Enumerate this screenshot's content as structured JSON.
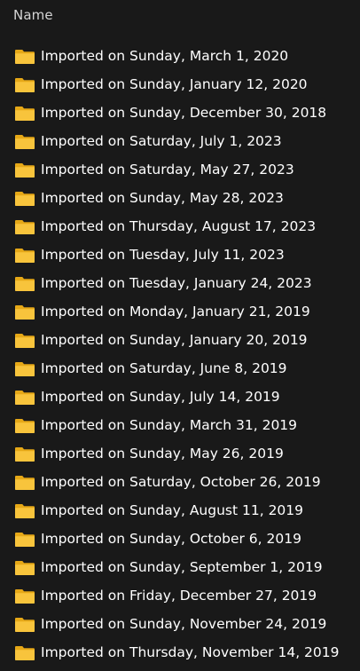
{
  "header": {
    "name_column": "Name"
  },
  "colors": {
    "background": "#191919",
    "folder_body": "#f8c43c",
    "folder_tab": "#e6a817",
    "text": "#ffffff"
  },
  "items": [
    {
      "label": "Imported on Sunday, March 1, 2020",
      "icon": "folder-icon"
    },
    {
      "label": "Imported on Sunday, January 12, 2020",
      "icon": "folder-icon"
    },
    {
      "label": "Imported on Sunday, December 30, 2018",
      "icon": "folder-icon"
    },
    {
      "label": "Imported on Saturday, July 1, 2023",
      "icon": "folder-icon"
    },
    {
      "label": "Imported on Saturday, May 27, 2023",
      "icon": "folder-icon"
    },
    {
      "label": "Imported on Sunday, May 28, 2023",
      "icon": "folder-icon"
    },
    {
      "label": "Imported on Thursday, August 17, 2023",
      "icon": "folder-icon"
    },
    {
      "label": "Imported on Tuesday, July 11, 2023",
      "icon": "folder-icon"
    },
    {
      "label": "Imported on Tuesday, January 24, 2023",
      "icon": "folder-icon"
    },
    {
      "label": "Imported on Monday, January 21, 2019",
      "icon": "folder-icon"
    },
    {
      "label": "Imported on Sunday, January 20, 2019",
      "icon": "folder-icon"
    },
    {
      "label": "Imported on Saturday, June 8, 2019",
      "icon": "folder-icon"
    },
    {
      "label": "Imported on Sunday, July 14, 2019",
      "icon": "folder-icon"
    },
    {
      "label": "Imported on Sunday, March 31, 2019",
      "icon": "folder-icon"
    },
    {
      "label": "Imported on Sunday, May 26, 2019",
      "icon": "folder-icon"
    },
    {
      "label": "Imported on Saturday, October 26, 2019",
      "icon": "folder-icon"
    },
    {
      "label": "Imported on Sunday, August 11, 2019",
      "icon": "folder-icon"
    },
    {
      "label": "Imported on Sunday, October 6, 2019",
      "icon": "folder-icon"
    },
    {
      "label": "Imported on Sunday, September 1, 2019",
      "icon": "folder-icon"
    },
    {
      "label": "Imported on Friday, December 27, 2019",
      "icon": "folder-icon"
    },
    {
      "label": "Imported on Sunday, November 24, 2019",
      "icon": "folder-icon"
    },
    {
      "label": "Imported on Thursday, November 14, 2019",
      "icon": "folder-icon"
    }
  ]
}
